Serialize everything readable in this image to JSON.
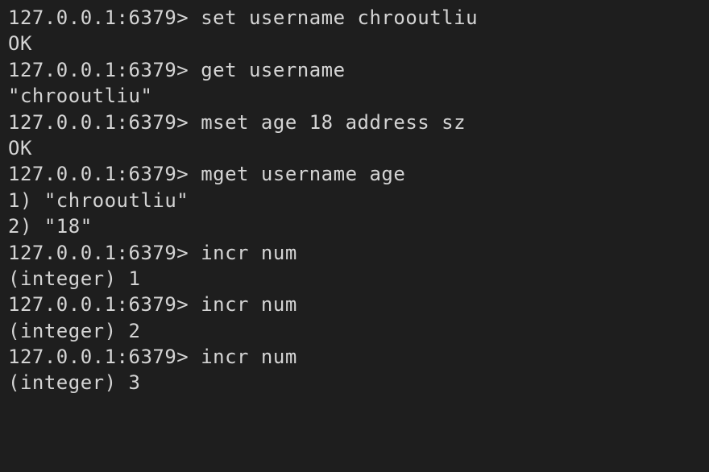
{
  "terminal": {
    "prompt": "127.0.0.1:6379> ",
    "lines": [
      {
        "type": "command",
        "command": "set username chrooutliu"
      },
      {
        "type": "response",
        "text": "OK"
      },
      {
        "type": "command",
        "command": "get username"
      },
      {
        "type": "response",
        "text": "\"chrooutliu\""
      },
      {
        "type": "command",
        "command": "mset age 18 address sz"
      },
      {
        "type": "response",
        "text": "OK"
      },
      {
        "type": "command",
        "command": "mget username age"
      },
      {
        "type": "response",
        "text": "1) \"chrooutliu\""
      },
      {
        "type": "response",
        "text": "2) \"18\""
      },
      {
        "type": "command",
        "command": "incr num"
      },
      {
        "type": "response",
        "text": "(integer) 1"
      },
      {
        "type": "command",
        "command": "incr num"
      },
      {
        "type": "response",
        "text": "(integer) 2"
      },
      {
        "type": "command",
        "command": "incr num"
      },
      {
        "type": "response",
        "text": "(integer) 3"
      }
    ]
  }
}
